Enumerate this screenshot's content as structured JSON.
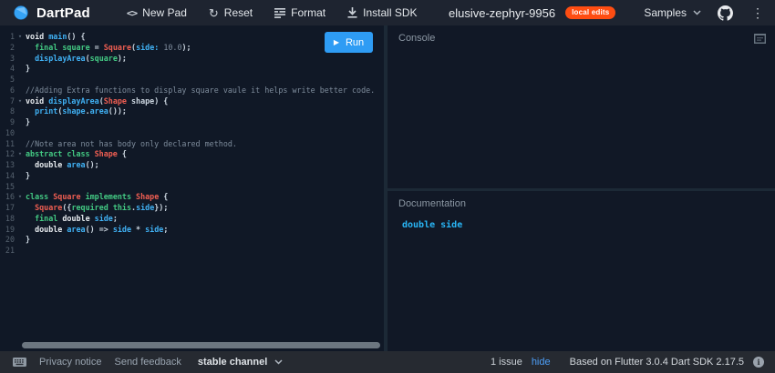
{
  "colors": {
    "accent_blue": "#2e9cf4",
    "badge_orange": "#fe4d12",
    "link_blue": "#4d9ff8",
    "code_keyword_green": "#43c983",
    "code_type_red": "#ef5e52",
    "code_function_cyan": "#40b1f4",
    "doc_cyan": "#29b6f6"
  },
  "topbar": {
    "brand": "DartPad",
    "actions": [
      {
        "label": "New Pad",
        "icon": "code-icon"
      },
      {
        "label": "Reset",
        "icon": "refresh-icon"
      },
      {
        "label": "Format",
        "icon": "format-icon"
      },
      {
        "label": "Install SDK",
        "icon": "download-icon"
      }
    ],
    "title": "elusive-zephyr-9956",
    "badge": "local edits",
    "samples_label": "Samples"
  },
  "editor": {
    "run_label": "Run",
    "lines": [
      {
        "n": 1,
        "fold": true,
        "t": [
          [
            "bi",
            "void "
          ],
          [
            "fn",
            "main"
          ],
          [
            "pln",
            "() {"
          ]
        ]
      },
      {
        "n": 2,
        "fold": false,
        "t": [
          [
            "pln",
            "  "
          ],
          [
            "kw",
            "final "
          ],
          [
            "def",
            "square"
          ],
          [
            "pln",
            " = "
          ],
          [
            "type",
            "Square"
          ],
          [
            "pln",
            "("
          ],
          [
            "fn",
            "side:"
          ],
          [
            "pln",
            " "
          ],
          [
            "num",
            "10.0"
          ],
          [
            "pln",
            ");"
          ]
        ]
      },
      {
        "n": 3,
        "fold": false,
        "t": [
          [
            "pln",
            "  "
          ],
          [
            "fn",
            "displayArea"
          ],
          [
            "pln",
            "("
          ],
          [
            "def",
            "square"
          ],
          [
            "pln",
            ");"
          ]
        ]
      },
      {
        "n": 4,
        "fold": false,
        "t": [
          [
            "pln",
            "}"
          ]
        ]
      },
      {
        "n": 5,
        "fold": false,
        "t": []
      },
      {
        "n": 6,
        "fold": false,
        "t": [
          [
            "cmt",
            "//Adding Extra functions to display square vaule it helps write better code."
          ]
        ]
      },
      {
        "n": 7,
        "fold": true,
        "t": [
          [
            "bi",
            "void "
          ],
          [
            "fn",
            "displayArea"
          ],
          [
            "pln",
            "("
          ],
          [
            "type",
            "Shape"
          ],
          [
            "pln",
            " shape) {"
          ]
        ]
      },
      {
        "n": 8,
        "fold": false,
        "t": [
          [
            "pln",
            "  "
          ],
          [
            "fn",
            "print"
          ],
          [
            "pln",
            "("
          ],
          [
            "fn",
            "shape"
          ],
          [
            "pln",
            "."
          ],
          [
            "fn",
            "area"
          ],
          [
            "pln",
            "());"
          ]
        ]
      },
      {
        "n": 9,
        "fold": false,
        "t": [
          [
            "pln",
            "}"
          ]
        ]
      },
      {
        "n": 10,
        "fold": false,
        "t": []
      },
      {
        "n": 11,
        "fold": false,
        "t": [
          [
            "cmt",
            "//Note area not has body only declared method."
          ]
        ]
      },
      {
        "n": 12,
        "fold": true,
        "t": [
          [
            "kw",
            "abstract class "
          ],
          [
            "type",
            "Shape"
          ],
          [
            "pln",
            " {"
          ]
        ]
      },
      {
        "n": 13,
        "fold": false,
        "t": [
          [
            "pln",
            "  "
          ],
          [
            "bi",
            "double "
          ],
          [
            "fn",
            "area"
          ],
          [
            "pln",
            "();"
          ]
        ]
      },
      {
        "n": 14,
        "fold": false,
        "t": [
          [
            "pln",
            "}"
          ]
        ]
      },
      {
        "n": 15,
        "fold": false,
        "t": []
      },
      {
        "n": 16,
        "fold": true,
        "t": [
          [
            "kw",
            "class "
          ],
          [
            "type",
            "Square"
          ],
          [
            "kw",
            " implements "
          ],
          [
            "type",
            "Shape"
          ],
          [
            "pln",
            " {"
          ]
        ]
      },
      {
        "n": 17,
        "fold": false,
        "t": [
          [
            "pln",
            "  "
          ],
          [
            "type",
            "Square"
          ],
          [
            "pln",
            "({"
          ],
          [
            "kw",
            "required "
          ],
          [
            "kw",
            "this"
          ],
          [
            "pln",
            "."
          ],
          [
            "fn",
            "side"
          ],
          [
            "pln",
            "});"
          ]
        ]
      },
      {
        "n": 18,
        "fold": false,
        "t": [
          [
            "pln",
            "  "
          ],
          [
            "kw",
            "final "
          ],
          [
            "bi",
            "double "
          ],
          [
            "fn",
            "side"
          ],
          [
            "pln",
            ";"
          ]
        ]
      },
      {
        "n": 19,
        "fold": false,
        "t": [
          [
            "pln",
            "  "
          ],
          [
            "bi",
            "double "
          ],
          [
            "fn",
            "area"
          ],
          [
            "pln",
            "() => "
          ],
          [
            "fn",
            "side"
          ],
          [
            "pln",
            " * "
          ],
          [
            "fn",
            "side"
          ],
          [
            "pln",
            ";"
          ]
        ]
      },
      {
        "n": 20,
        "fold": false,
        "t": [
          [
            "pln",
            "}"
          ]
        ]
      },
      {
        "n": 21,
        "fold": false,
        "t": []
      }
    ]
  },
  "console": {
    "header": "Console"
  },
  "documentation": {
    "header": "Documentation",
    "content": "double side"
  },
  "statusbar": {
    "privacy": "Privacy notice",
    "feedback": "Send feedback",
    "channel": "stable channel",
    "issues": "1 issue",
    "hide_label": "hide",
    "based_on": "Based on Flutter 3.0.4 Dart SDK 2.17.5"
  }
}
